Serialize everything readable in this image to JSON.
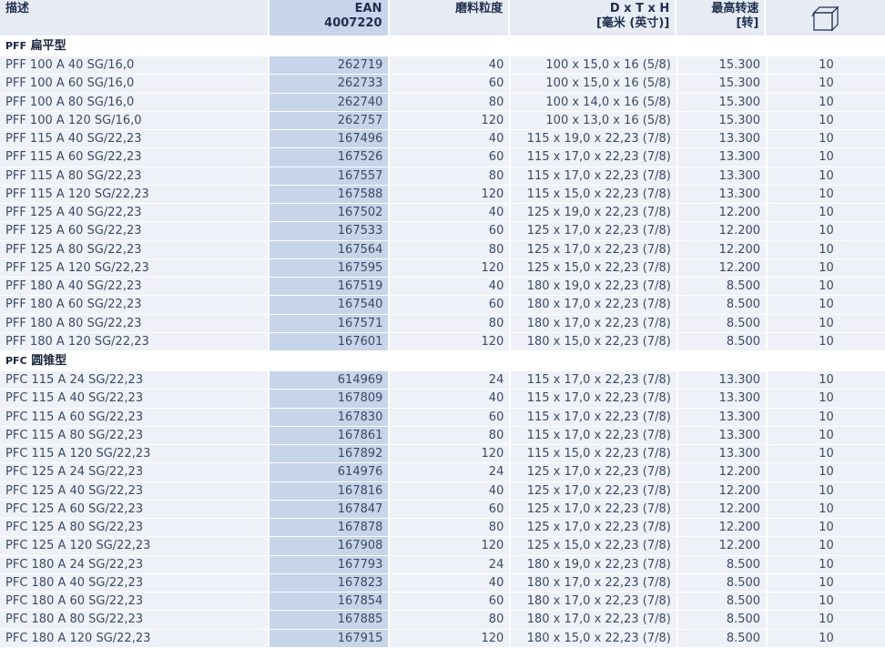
{
  "headers": {
    "desc": "描述",
    "ean_line1": "EAN",
    "ean_line2": "4007220",
    "grit": "磨料粒度",
    "dim_line1": "D x T x H",
    "dim_line2": "[毫米 (英寸)]",
    "speed_line1": "最高转速",
    "speed_line2": "[转]",
    "qty_icon": "box-icon"
  },
  "sections": [
    {
      "code": "PFF",
      "name": "扁平型",
      "rows": [
        {
          "desc": "PFF 100 A 40 SG/16,0",
          "ean": "262719",
          "grit": "40",
          "dim": "100 x 15,0 x 16 (5/8)",
          "speed": "15.300",
          "qty": "10"
        },
        {
          "desc": "PFF 100 A 60 SG/16,0",
          "ean": "262733",
          "grit": "60",
          "dim": "100 x 15,0 x 16 (5/8)",
          "speed": "15.300",
          "qty": "10"
        },
        {
          "desc": "PFF 100 A 80 SG/16,0",
          "ean": "262740",
          "grit": "80",
          "dim": "100 x 14,0 x 16 (5/8)",
          "speed": "15.300",
          "qty": "10"
        },
        {
          "desc": "PFF 100 A 120 SG/16,0",
          "ean": "262757",
          "grit": "120",
          "dim": "100 x 13,0 x 16 (5/8)",
          "speed": "15.300",
          "qty": "10"
        },
        {
          "desc": "PFF 115 A 40 SG/22,23",
          "ean": "167496",
          "grit": "40",
          "dim": "115 x 19,0 x 22,23 (7/8)",
          "speed": "13.300",
          "qty": "10"
        },
        {
          "desc": "PFF 115 A 60 SG/22,23",
          "ean": "167526",
          "grit": "60",
          "dim": "115 x 17,0 x 22,23 (7/8)",
          "speed": "13.300",
          "qty": "10"
        },
        {
          "desc": "PFF 115 A 80 SG/22,23",
          "ean": "167557",
          "grit": "80",
          "dim": "115 x 17,0 x 22,23 (7/8)",
          "speed": "13.300",
          "qty": "10"
        },
        {
          "desc": "PFF 115 A 120 SG/22,23",
          "ean": "167588",
          "grit": "120",
          "dim": "115 x 15,0 x 22,23 (7/8)",
          "speed": "13.300",
          "qty": "10"
        },
        {
          "desc": "PFF 125 A 40 SG/22,23",
          "ean": "167502",
          "grit": "40",
          "dim": "125 x 19,0 x 22,23 (7/8)",
          "speed": "12.200",
          "qty": "10"
        },
        {
          "desc": "PFF 125 A 60 SG/22,23",
          "ean": "167533",
          "grit": "60",
          "dim": "125 x 17,0 x 22,23 (7/8)",
          "speed": "12.200",
          "qty": "10"
        },
        {
          "desc": "PFF 125 A 80 SG/22,23",
          "ean": "167564",
          "grit": "80",
          "dim": "125 x 17,0 x 22,23 (7/8)",
          "speed": "12.200",
          "qty": "10"
        },
        {
          "desc": "PFF 125 A 120 SG/22,23",
          "ean": "167595",
          "grit": "120",
          "dim": "125 x 15,0 x 22,23 (7/8)",
          "speed": "12.200",
          "qty": "10"
        },
        {
          "desc": "PFF 180 A 40 SG/22,23",
          "ean": "167519",
          "grit": "40",
          "dim": "180 x 19,0 x 22,23 (7/8)",
          "speed": "8.500",
          "qty": "10"
        },
        {
          "desc": "PFF 180 A 60 SG/22,23",
          "ean": "167540",
          "grit": "60",
          "dim": "180 x 17,0 x 22,23 (7/8)",
          "speed": "8.500",
          "qty": "10"
        },
        {
          "desc": "PFF 180 A 80 SG/22,23",
          "ean": "167571",
          "grit": "80",
          "dim": "180 x 17,0 x 22,23 (7/8)",
          "speed": "8.500",
          "qty": "10"
        },
        {
          "desc": "PFF 180 A 120 SG/22,23",
          "ean": "167601",
          "grit": "120",
          "dim": "180 x 15,0 x 22,23 (7/8)",
          "speed": "8.500",
          "qty": "10"
        }
      ]
    },
    {
      "code": "PFC",
      "name": "圆锥型",
      "rows": [
        {
          "desc": "PFC 115 A 24 SG/22,23",
          "ean": "614969",
          "grit": "24",
          "dim": "115 x 17,0 x 22,23 (7/8)",
          "speed": "13.300",
          "qty": "10"
        },
        {
          "desc": "PFC 115 A 40 SG/22,23",
          "ean": "167809",
          "grit": "40",
          "dim": "115 x 17,0 x 22,23 (7/8)",
          "speed": "13.300",
          "qty": "10"
        },
        {
          "desc": "PFC 115 A 60 SG/22,23",
          "ean": "167830",
          "grit": "60",
          "dim": "115 x 17,0 x 22,23 (7/8)",
          "speed": "13.300",
          "qty": "10"
        },
        {
          "desc": "PFC 115 A 80 SG/22,23",
          "ean": "167861",
          "grit": "80",
          "dim": "115 x 17,0 x 22,23 (7/8)",
          "speed": "13.300",
          "qty": "10"
        },
        {
          "desc": "PFC 115 A 120 SG/22,23",
          "ean": "167892",
          "grit": "120",
          "dim": "115 x 15,0 x 22,23 (7/8)",
          "speed": "13.300",
          "qty": "10"
        },
        {
          "desc": "PFC 125 A 24 SG/22,23",
          "ean": "614976",
          "grit": "24",
          "dim": "125 x 17,0 x 22,23 (7/8)",
          "speed": "12.200",
          "qty": "10"
        },
        {
          "desc": "PFC 125 A 40 SG/22,23",
          "ean": "167816",
          "grit": "40",
          "dim": "125 x 17,0 x 22,23 (7/8)",
          "speed": "12.200",
          "qty": "10"
        },
        {
          "desc": "PFC 125 A 60 SG/22,23",
          "ean": "167847",
          "grit": "60",
          "dim": "125 x 17,0 x 22,23 (7/8)",
          "speed": "12.200",
          "qty": "10"
        },
        {
          "desc": "PFC 125 A 80 SG/22,23",
          "ean": "167878",
          "grit": "80",
          "dim": "125 x 17,0 x 22,23 (7/8)",
          "speed": "12.200",
          "qty": "10"
        },
        {
          "desc": "PFC 125 A 120 SG/22,23",
          "ean": "167908",
          "grit": "120",
          "dim": "125 x 15,0 x 22,23 (7/8)",
          "speed": "12.200",
          "qty": "10"
        },
        {
          "desc": "PFC 180 A 24 SG/22,23",
          "ean": "167793",
          "grit": "24",
          "dim": "180 x 19,0 x 22,23 (7/8)",
          "speed": "8.500",
          "qty": "10"
        },
        {
          "desc": "PFC 180 A 40 SG/22,23",
          "ean": "167823",
          "grit": "40",
          "dim": "180 x 17,0 x 22,23 (7/8)",
          "speed": "8.500",
          "qty": "10"
        },
        {
          "desc": "PFC 180 A 60 SG/22,23",
          "ean": "167854",
          "grit": "60",
          "dim": "180 x 17,0 x 22,23 (7/8)",
          "speed": "8.500",
          "qty": "10"
        },
        {
          "desc": "PFC 180 A 80 SG/22,23",
          "ean": "167885",
          "grit": "80",
          "dim": "180 x 17,0 x 22,23 (7/8)",
          "speed": "8.500",
          "qty": "10"
        },
        {
          "desc": "PFC 180 A 120 SG/22,23",
          "ean": "167915",
          "grit": "120",
          "dim": "180 x 15,0 x 22,23 (7/8)",
          "speed": "8.500",
          "qty": "10"
        }
      ]
    }
  ]
}
